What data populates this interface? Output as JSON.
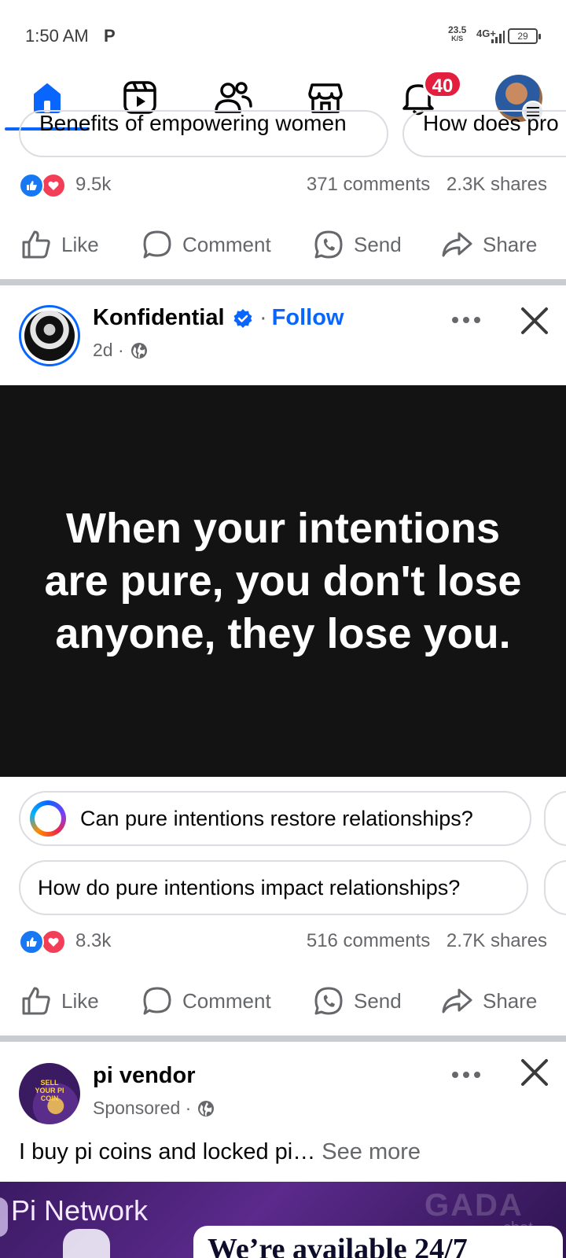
{
  "status_bar": {
    "time": "1:50 AM",
    "app_indicator": "P",
    "speed_value": "23.5",
    "speed_unit": "K/S",
    "network": "4G+",
    "battery": "29"
  },
  "nav": {
    "items": [
      "home-icon",
      "reels-icon",
      "friends-icon",
      "marketplace-icon",
      "notifications-icon",
      "profile-avatar"
    ],
    "notification_badge": "40",
    "accent_color": "#0866ff"
  },
  "top_post": {
    "chips": [
      "Benefits of empowering women",
      "How does pro"
    ],
    "reactions": {
      "count": "9.5k",
      "comments": "371 comments",
      "shares": "2.3K shares"
    }
  },
  "actions": {
    "like": "Like",
    "comment": "Comment",
    "send": "Send",
    "share": "Share"
  },
  "post": {
    "author": "Konfidential",
    "separator": "·",
    "follow": "Follow",
    "time": "2d ·",
    "quote": "When your intentions are pure, you don't lose anyone, they lose you.",
    "suggestions": [
      "Can pure intentions restore relationships?",
      "How do pure intentions impact relationships?"
    ],
    "reactions": {
      "count": "8.3k",
      "comments": "516 comments",
      "shares": "2.7K shares"
    }
  },
  "ad": {
    "advertiser": "pi vendor",
    "label": "Sponsored ·",
    "avatar_text": "SELL YOUR PI COIN",
    "text": "I buy pi coins and locked pi…",
    "see_more": "See more",
    "banner_title": "Pi Network",
    "banner_text": "We’re available 24/7",
    "watermark": "GADA",
    "watermark_sub": "chat"
  }
}
